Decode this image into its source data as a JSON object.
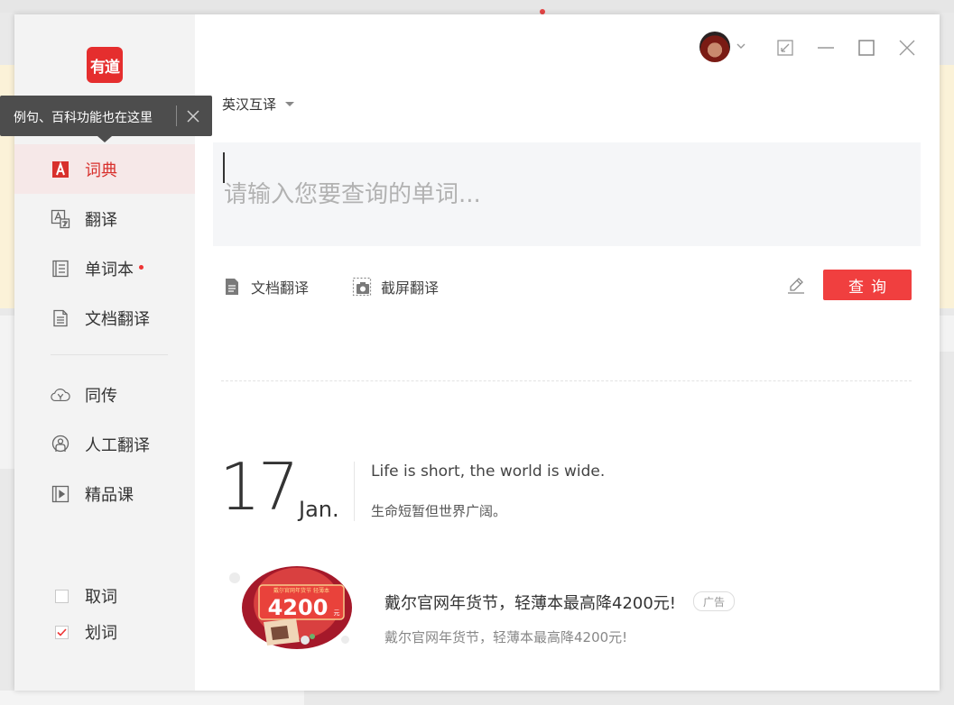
{
  "app": {
    "logo_text": "有道"
  },
  "tooltip": {
    "text": "例句、百科功能也在这里"
  },
  "sidebar": {
    "items": [
      {
        "label": "词典"
      },
      {
        "label": "翻译"
      },
      {
        "label": "单词本"
      },
      {
        "label": "文档翻译"
      },
      {
        "label": "同传"
      },
      {
        "label": "人工翻译"
      },
      {
        "label": "精品课"
      }
    ],
    "checks": [
      {
        "label": "取词",
        "checked": false
      },
      {
        "label": "划词",
        "checked": true
      }
    ]
  },
  "main": {
    "language": "英汉互译",
    "search_placeholder": "请输入您要查询的单词...",
    "tools": {
      "doc_translate": "文档翻译",
      "screenshot_translate": "截屏翻译"
    },
    "query_button": "查询"
  },
  "daily": {
    "day": "17",
    "month": "Jan.",
    "sentence_en": "Life is short, the world is wide.",
    "sentence_zh": "生命短暂但世界广阔。"
  },
  "ad": {
    "badge_number": "4200",
    "badge_unit": "元",
    "badge_caption": "戴尔官网年货节 轻薄本",
    "title": "戴尔官网年货节，轻薄本最高降4200元!",
    "tag": "广告",
    "subtitle": "戴尔官网年货节，轻薄本最高降4200元!"
  },
  "colors": {
    "accent": "#f03f3f",
    "sidebar_bg": "#f3f3f3",
    "active_bg": "#f6e8e8",
    "active_text": "#d8302c"
  }
}
